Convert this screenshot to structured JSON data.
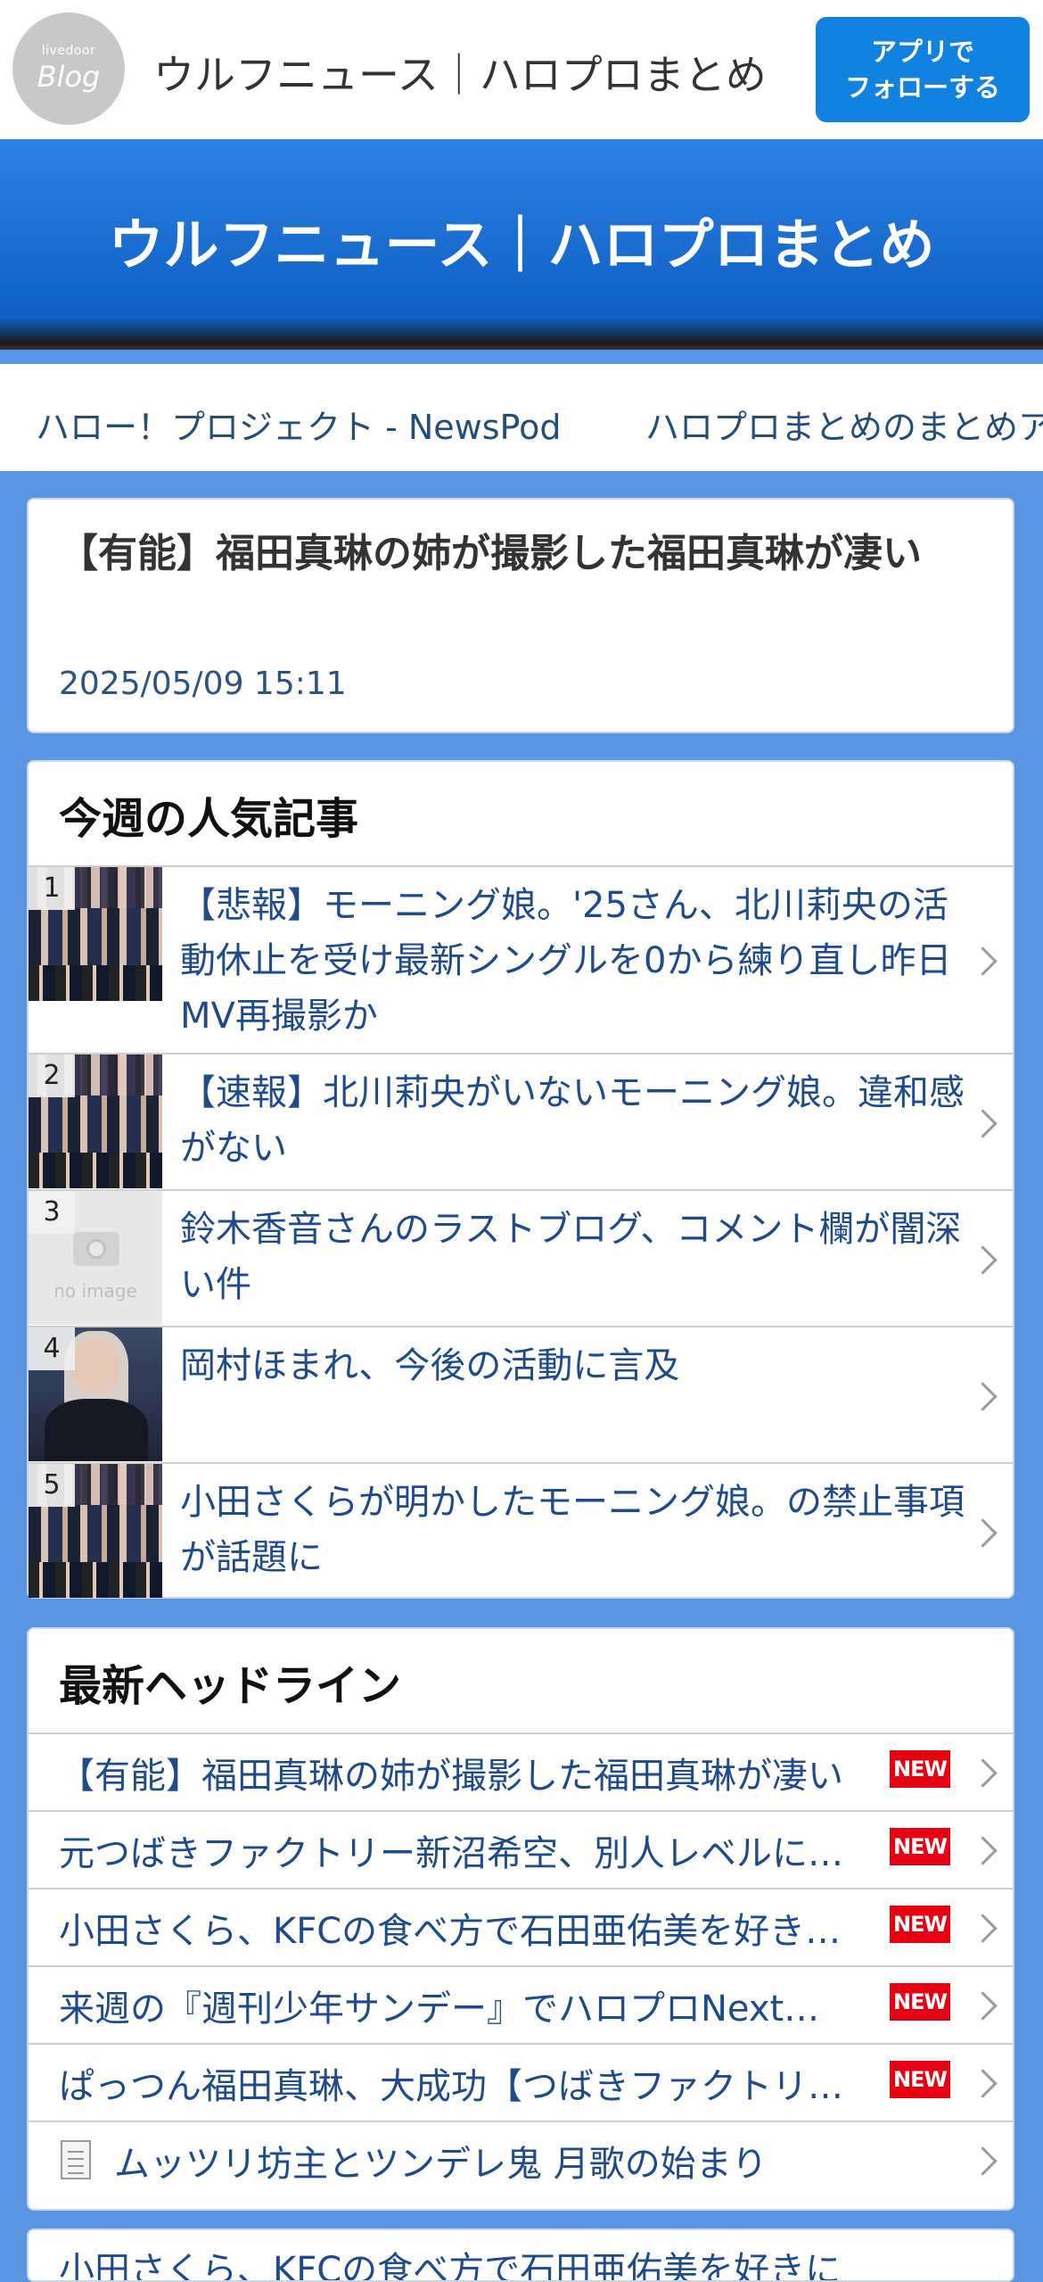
{
  "header": {
    "logo_small": "livedoor",
    "logo_big": "Blog",
    "title": "ウルフニュース｜ハロプロまとめ",
    "follow_line1": "アプリで",
    "follow_line2": "フォローする"
  },
  "hero": {
    "title": "ウルフニュース｜ハロプロまとめ"
  },
  "nav": {
    "items": [
      "ハロー！プロジェクト - NewsPod",
      "ハロプロまとめのまとめア"
    ]
  },
  "article": {
    "title": "【有能】福田真琳の姉が撮影した福田真琳が凄い",
    "date": "2025/05/09 15:11"
  },
  "popular": {
    "heading": "今週の人気記事",
    "no_image_label": "no image",
    "items": [
      {
        "rank": "1",
        "title": "【悲報】モーニング娘。'25さん、北川莉央の活動休止を受け最新シングルを0から練り直し昨日MV再撮影か"
      },
      {
        "rank": "2",
        "title": "【速報】北川莉央がいないモーニング娘。違和感がない"
      },
      {
        "rank": "3",
        "title": "鈴木香音さんのラストブログ、コメント欄が闇深い件"
      },
      {
        "rank": "4",
        "title": "岡村ほまれ、今後の活動に言及"
      },
      {
        "rank": "5",
        "title": "小田さくらが明かしたモーニング娘。の禁止事項が話題に"
      }
    ]
  },
  "headlines": {
    "heading": "最新ヘッドライン",
    "new_label": "NEW",
    "items": [
      {
        "title": "【有能】福田真琳の姉が撮影した福田真琳が凄い"
      },
      {
        "title": "元つばきファクトリー新沼希空、別人レベルに…"
      },
      {
        "title": "小田さくら、KFCの食べ方で石田亜佑美を好き…"
      },
      {
        "title": "来週の『週刊少年サンデー』でハロプロNext…"
      },
      {
        "title": "ぱっつん福田真琳、大成功【つばきファクトリ…"
      }
    ],
    "external": {
      "title": "ムッツリ坊主とツンデレ鬼 月歌の始まり"
    }
  },
  "bottom_peek": {
    "title": "小田さくら、KFCの食べ方で石田亜佑美を好きに"
  }
}
